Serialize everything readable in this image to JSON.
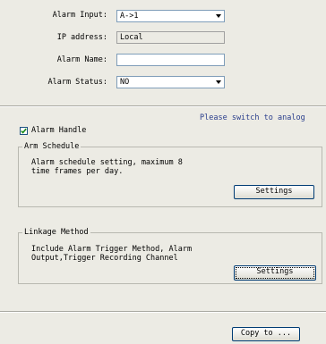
{
  "form": {
    "alarm_input_label": "Alarm Input:",
    "alarm_input_value": "A->1",
    "ip_address_label": "IP address:",
    "ip_address_value": "Local",
    "alarm_name_label": "Alarm Name:",
    "alarm_name_value": "",
    "alarm_status_label": "Alarm Status:",
    "alarm_status_value": "NO"
  },
  "note": "Please switch to analog",
  "alarm_handle": {
    "label": "Alarm Handle",
    "checked": true
  },
  "arm_schedule": {
    "title": "Arm Schedule",
    "description": "Alarm schedule setting, maximum 8\ntime frames per day.",
    "button": "Settings"
  },
  "linkage": {
    "title": "Linkage Method",
    "description": "Include Alarm Trigger Method, Alarm\nOutput,Trigger Recording Channel",
    "button": "Settings"
  },
  "footer": {
    "copy_button": "Copy to ..."
  }
}
